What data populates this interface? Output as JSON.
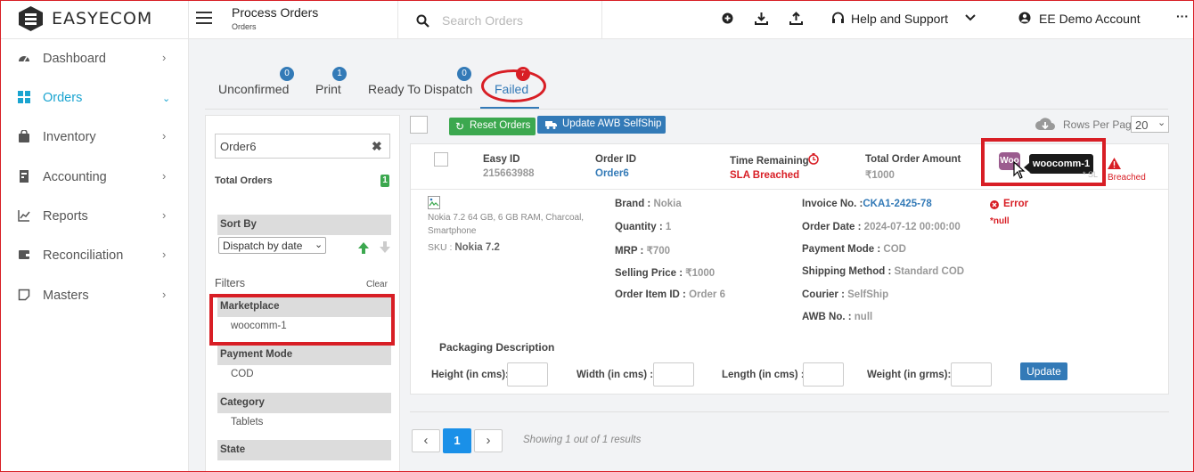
{
  "brand": {
    "name": "EASYECOM"
  },
  "header": {
    "page_title": "Process Orders",
    "breadcrumb": "Orders",
    "search_placeholder": "Search Orders",
    "help_label": "Help and Support",
    "account_label": "EE Demo Account",
    "more": "···"
  },
  "sidebar": {
    "items": [
      {
        "label": "Dashboard",
        "icon": "dashboard-icon"
      },
      {
        "label": "Orders",
        "icon": "grid-icon",
        "active": true
      },
      {
        "label": "Inventory",
        "icon": "bag-icon"
      },
      {
        "label": "Accounting",
        "icon": "ledger-icon"
      },
      {
        "label": "Reports",
        "icon": "chart-icon"
      },
      {
        "label": "Reconciliation",
        "icon": "wallet-icon"
      },
      {
        "label": "Masters",
        "icon": "note-icon"
      }
    ]
  },
  "tabs": [
    {
      "label": "Unconfirmed",
      "count": "0"
    },
    {
      "label": "Print",
      "count": "1"
    },
    {
      "label": "Ready To Dispatch",
      "count": "0"
    },
    {
      "label": "Failed",
      "count": "7"
    }
  ],
  "filters": {
    "search_value": "Order6",
    "total_label": "Total Orders",
    "total_count": "1",
    "sort_label": "Sort By",
    "sort_value": "Dispatch by date",
    "filters_label": "Filters",
    "clear_label": "Clear",
    "groups": [
      {
        "title": "Marketplace",
        "value": "woocomm-1"
      },
      {
        "title": "Payment Mode",
        "value": "COD"
      },
      {
        "title": "Category",
        "value": "Tablets"
      },
      {
        "title": "State",
        "value": ""
      }
    ]
  },
  "toolbar": {
    "reset_label": "Reset Orders",
    "update_awb_label": "Update AWB SelfShip",
    "rows_label": "Rows Per Page",
    "rows_value": "20"
  },
  "order": {
    "easy_id_label": "Easy ID",
    "easy_id": "215663988",
    "order_id_label": "Order ID",
    "order_id": "Order6",
    "time_label": "Time Remaining",
    "time_value": "SLA Breached",
    "total_label": "Total Order Amount",
    "total_value": "₹1000",
    "marketplace_logo": "Woo",
    "marketplace_tooltip": "woocomm-1",
    "breached_text": "Breached",
    "faded_text": "* SL",
    "product_name": "Nokia 7.2 64 GB, 6 GB RAM, Charcoal, Smartphone",
    "sku_label": "SKU : ",
    "sku_value": "Nokia 7.2",
    "brand_label": "Brand : ",
    "brand_value": "Nokia",
    "qty_label": "Quantity : ",
    "qty_value": "1",
    "mrp_label": "MRP : ",
    "mrp_value": "₹700",
    "sp_label": "Selling Price : ",
    "sp_value": "₹1000",
    "oi_label": "Order Item ID : ",
    "oi_value": "Order 6",
    "inv_label": "Invoice No. :",
    "inv_value": "CKA1-2425-78",
    "date_label": "Order Date : ",
    "date_value": "2024-07-12 00:00:00",
    "pay_label": "Payment Mode : ",
    "pay_value": "COD",
    "ship_label": "Shipping Method : ",
    "ship_value": "Standard COD",
    "courier_label": "Courier : ",
    "courier_value": "SelfShip",
    "awb_label": "AWB No. : ",
    "awb_value": "null",
    "error_label": "Error",
    "error_detail": "*null",
    "pack_title": "Packaging Description",
    "height_label": "Height (in cms):",
    "width_label": "Width (in cms) :",
    "length_label": "Length (in cms) :",
    "weight_label": "Weight (in grms):",
    "update_label": "Update"
  },
  "pagination": {
    "prev": "‹",
    "page": "1",
    "next": "›",
    "summary": "Showing 1 out of 1 results"
  },
  "colors": {
    "accent": "#1aa4d0",
    "primary": "#337ab7",
    "danger": "#d81e25",
    "success": "#3ca84f",
    "woo": "#9b5c8f"
  }
}
